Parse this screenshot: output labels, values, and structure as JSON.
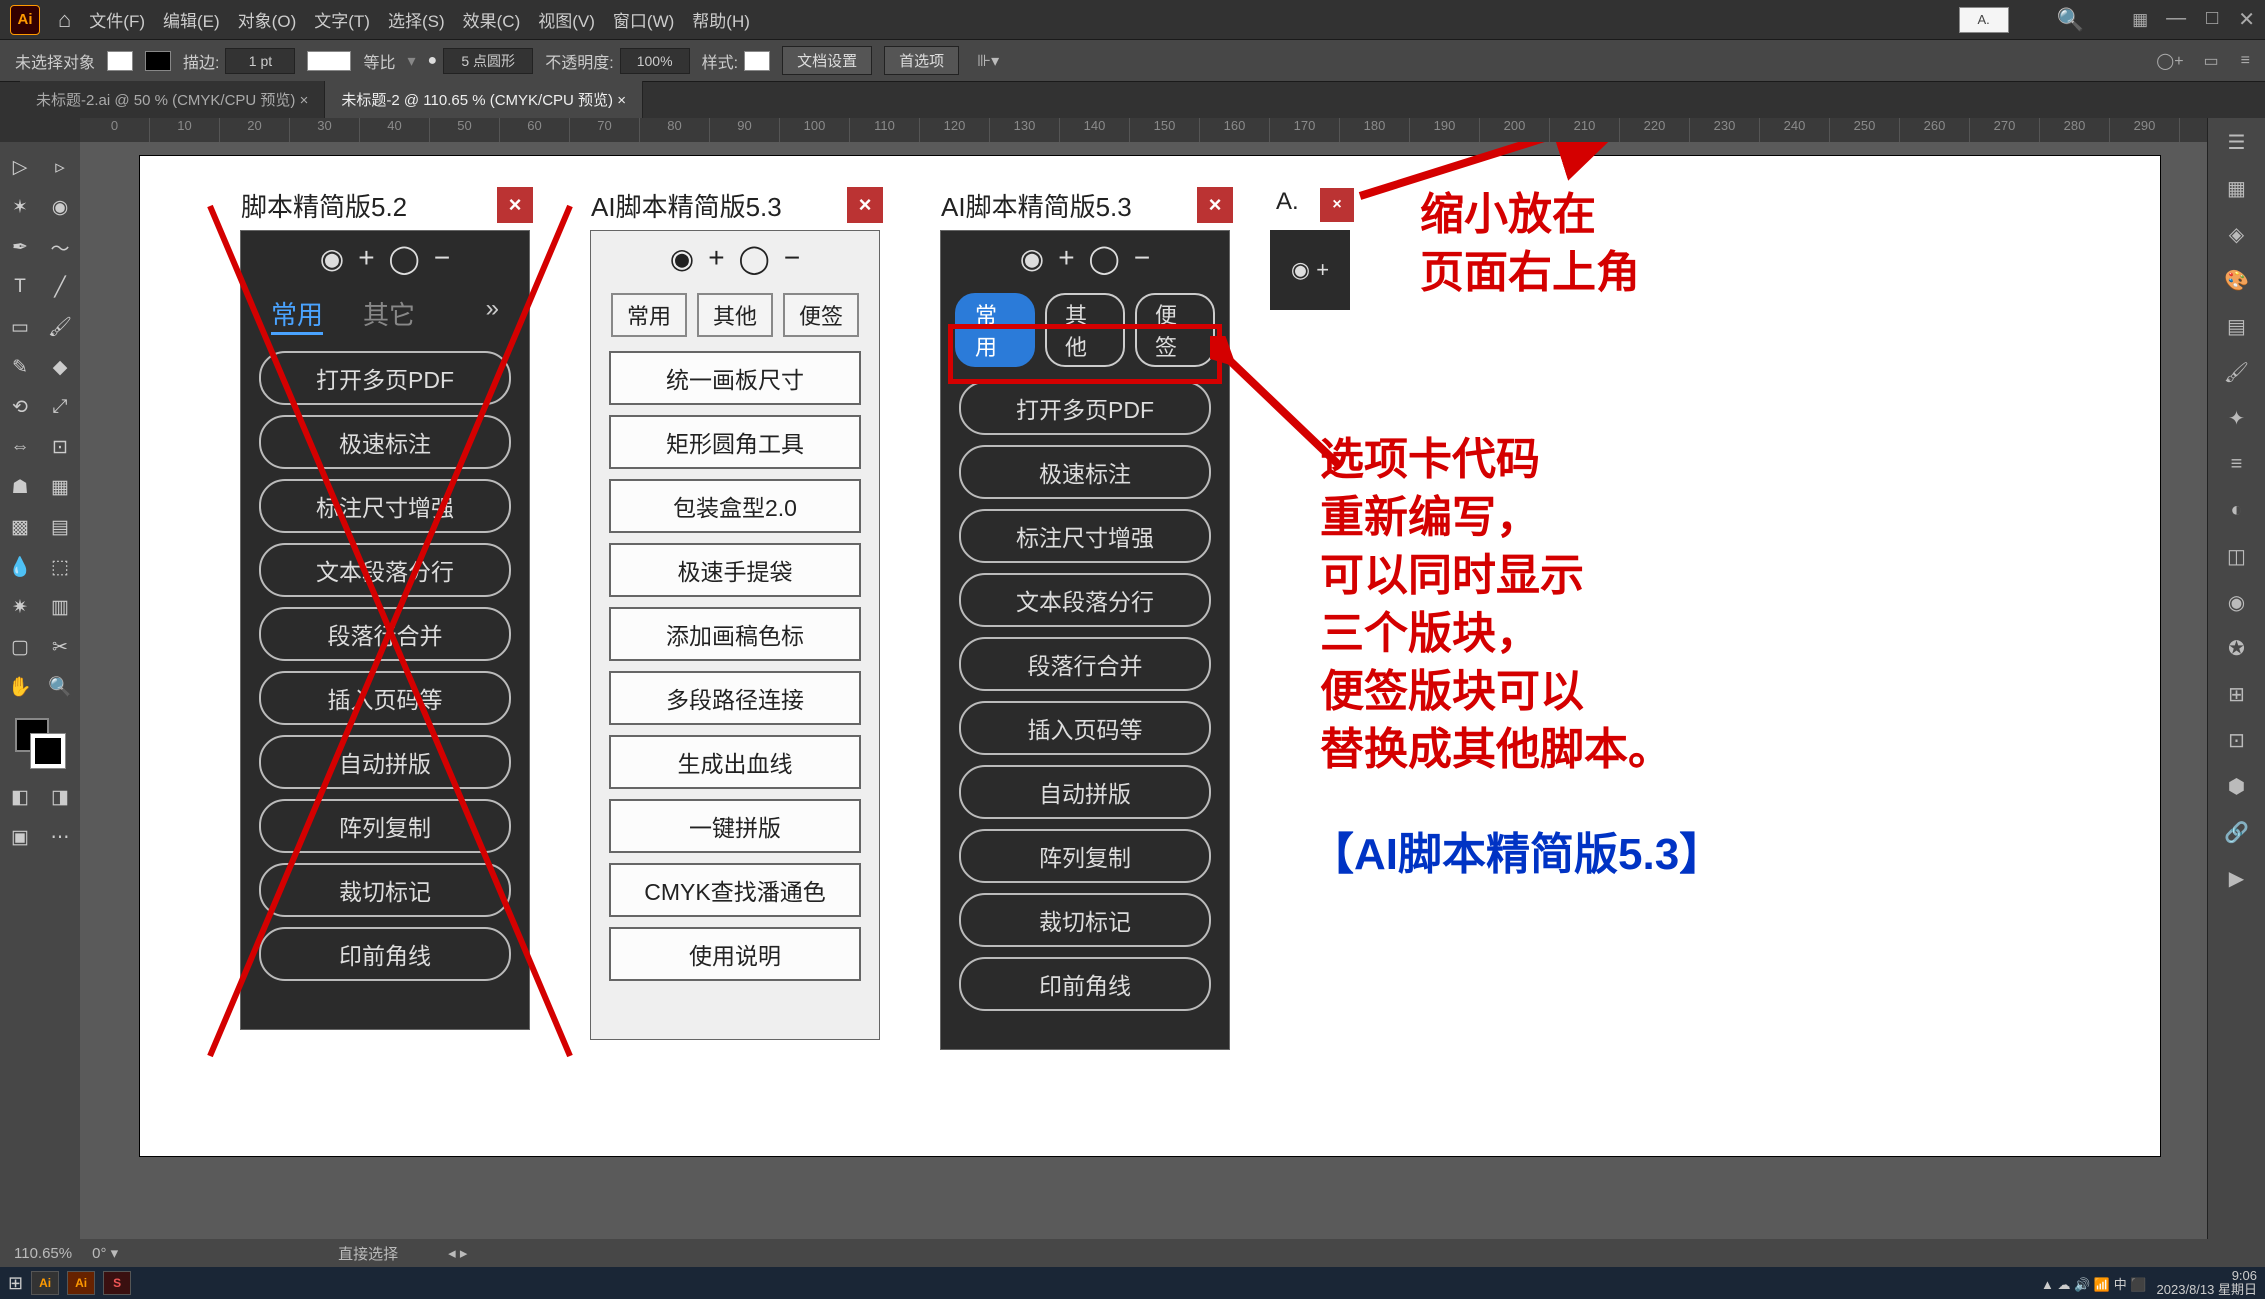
{
  "menubar": [
    "文件(F)",
    "编辑(E)",
    "对象(O)",
    "文字(T)",
    "选择(S)",
    "效果(C)",
    "视图(V)",
    "窗口(W)",
    "帮助(H)"
  ],
  "mini_top": "A.",
  "controlbar": {
    "noselect": "未选择对象",
    "stroke_lbl": "描边:",
    "stroke_val": "1 pt",
    "uniform": "等比",
    "round": "5 点圆形",
    "opacity_lbl": "不透明度:",
    "opacity_val": "100%",
    "style_lbl": "样式:",
    "docsetup": "文档设置",
    "prefs": "首选项"
  },
  "tabs": [
    {
      "label": "未标题-2.ai @ 50 % (CMYK/CPU 预览)",
      "active": false
    },
    {
      "label": "未标题-2 @ 110.65 % (CMYK/CPU 预览)",
      "active": true
    }
  ],
  "ruler_values": [
    "0",
    "10",
    "20",
    "30",
    "40",
    "50",
    "60",
    "70",
    "80",
    "90",
    "100",
    "110",
    "120",
    "130",
    "140",
    "150",
    "160",
    "170",
    "180",
    "190",
    "200",
    "210",
    "220",
    "230",
    "240",
    "250",
    "260",
    "270",
    "280",
    "290"
  ],
  "status": {
    "zoom": "110.65%",
    "mode": "直接选择"
  },
  "panel52": {
    "title": "脚本精简版5.2",
    "tabs": [
      "常用",
      "其它"
    ],
    "items": [
      "打开多页PDF",
      "极速标注",
      "标注尺寸增强",
      "文本段落分行",
      "段落行合并",
      "插入页码等",
      "自动拼版",
      "阵列复制",
      "裁切标记",
      "印前角线"
    ]
  },
  "panel53_light": {
    "title": "AI脚本精简版5.3",
    "tabs": [
      "常用",
      "其他",
      "便签"
    ],
    "items": [
      "统一画板尺寸",
      "矩形圆角工具",
      "包装盒型2.0",
      "极速手提袋",
      "添加画稿色标",
      "多段路径连接",
      "生成出血线",
      "一键拼版",
      "CMYK查找潘通色",
      "使用说明"
    ]
  },
  "panel53_dark": {
    "title": "AI脚本精简版5.3",
    "tabs": [
      "常用",
      "其他",
      "便签"
    ],
    "items": [
      "打开多页PDF",
      "极速标注",
      "标注尺寸增强",
      "文本段落分行",
      "段落行合并",
      "插入页码等",
      "自动拼版",
      "阵列复制",
      "裁切标记",
      "印前角线"
    ]
  },
  "mini_panel": {
    "title": "A.",
    "plus": "◉ +"
  },
  "annot1": "缩小放在\n页面右上角",
  "annot2": "选项卡代码\n重新编写，\n可以同时显示\n三个版块，\n便签版块可以\n替换成其他脚本。",
  "annot3": "【AI脚本精简版5.3】",
  "taskbar": {
    "time": "9:06",
    "date": "2023/8/13 星期日"
  }
}
